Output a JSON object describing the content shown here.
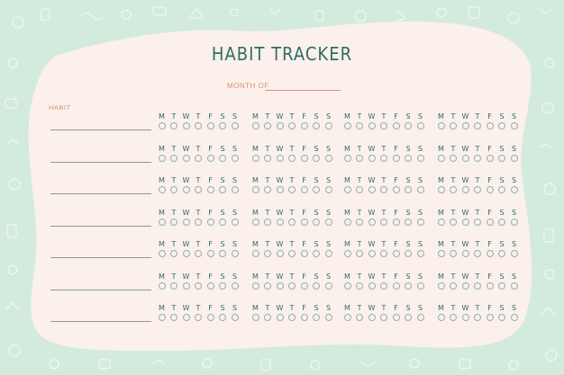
{
  "title": "HABIT TRACKER",
  "month_label": "MONTH OF",
  "habit_label": "HABIT",
  "days": [
    "M",
    "T",
    "W",
    "T",
    "F",
    "S",
    "S"
  ],
  "rows": 7,
  "weeks_per_row": 4,
  "colors": {
    "background": "#d3ebdc",
    "paper": "#fbf0eb",
    "title": "#2f6d66",
    "accent": "#e0907a",
    "circle": "#8fb1ab"
  }
}
